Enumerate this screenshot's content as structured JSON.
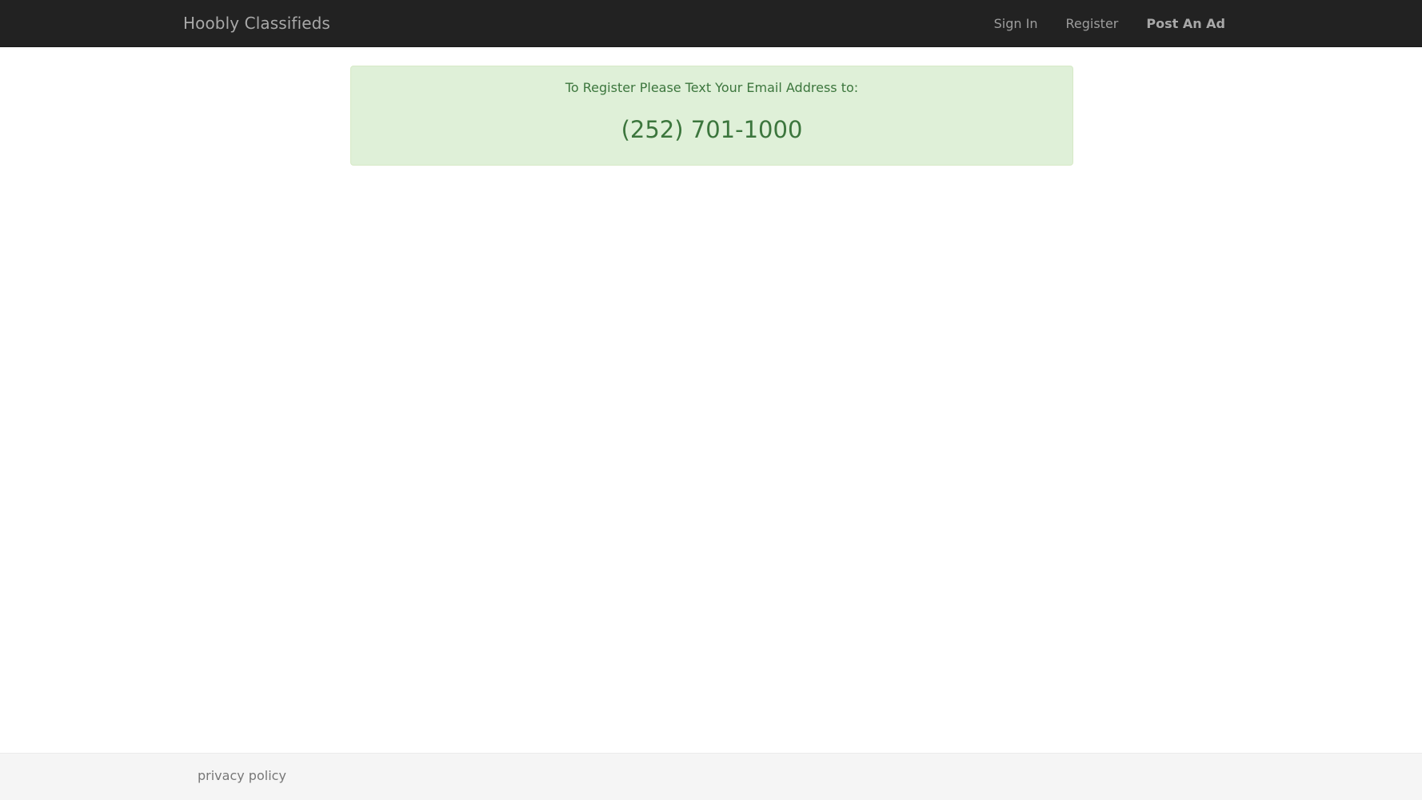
{
  "navbar": {
    "brand": "Hoobly Classifieds",
    "links": {
      "sign_in": "Sign In",
      "register": "Register",
      "post_ad": "Post An Ad"
    }
  },
  "alert": {
    "message": "To Register Please Text Your Email Address to:",
    "phone": "(252) 701-1000"
  },
  "footer": {
    "privacy": "privacy policy"
  },
  "colors": {
    "navbar_bg": "#222222",
    "alert_bg": "#dff0d8",
    "alert_text": "#3c763d",
    "footer_bg": "#f5f5f5"
  }
}
